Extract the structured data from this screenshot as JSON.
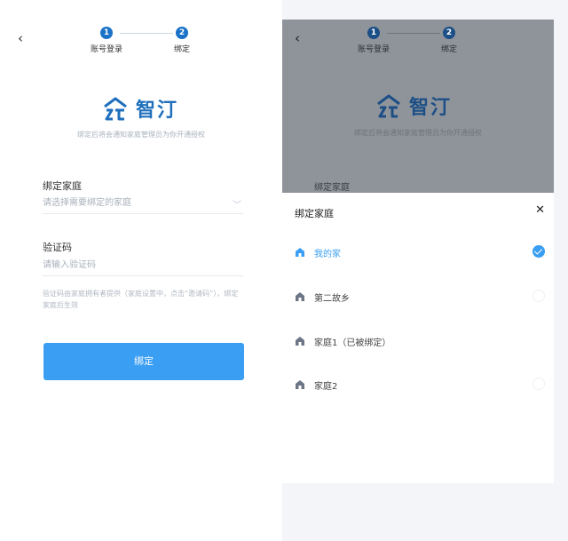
{
  "left": {
    "steps": [
      {
        "num": "1",
        "label": "账号登录"
      },
      {
        "num": "2",
        "label": "绑定"
      }
    ],
    "brand": "智汀",
    "subtitle": "绑定后将会通知家庭管理员为你开通授权",
    "family_label": "绑定家庭",
    "family_placeholder": "请选择需要绑定的家庭",
    "code_label": "验证码",
    "code_placeholder": "请输入验证码",
    "hint": "验证码由家庭拥有者提供（家庭设置中，点击“邀请码”），绑定家庭后生效",
    "bind_label": "绑定"
  },
  "right": {
    "steps": [
      {
        "num": "1",
        "label": "账号登录"
      },
      {
        "num": "2",
        "label": "绑定"
      }
    ],
    "brand": "智汀",
    "subtitle": "绑定后将会通知家庭管理员为你开通授权",
    "dim_label": "绑定家庭",
    "sheet": {
      "title": "绑定家庭",
      "items": [
        {
          "name": "我的家",
          "selected": true
        },
        {
          "name": "第二故乡",
          "selected": false
        },
        {
          "name": "家庭1（已被绑定）",
          "selected": false
        },
        {
          "name": "家庭2",
          "selected": false
        }
      ]
    }
  },
  "colors": {
    "accent": "#3a9ef2",
    "brand": "#1f6fbd",
    "overlay": "#8f949b"
  }
}
